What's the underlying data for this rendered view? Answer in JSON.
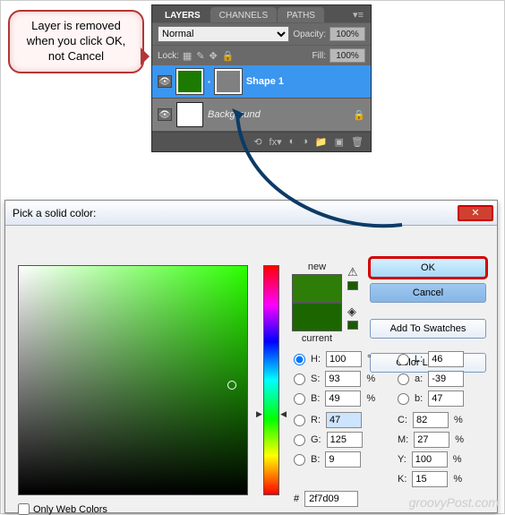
{
  "callout": {
    "text": "Layer is removed when you click OK, not Cancel"
  },
  "layers_panel": {
    "tabs": [
      "LAYERS",
      "CHANNELS",
      "PATHS"
    ],
    "blend_mode": "Normal",
    "opacity_label": "Opacity:",
    "opacity_val": "100%",
    "lock_label": "Lock:",
    "fill_label": "Fill:",
    "fill_val": "100%",
    "layers": [
      {
        "name": "Shape 1",
        "selected": true,
        "color": "#1c7a00"
      },
      {
        "name": "Background",
        "selected": false,
        "locked": true
      }
    ]
  },
  "color_picker": {
    "title": "Pick a solid color:",
    "new_label": "new",
    "current_label": "current",
    "buttons": {
      "ok": "OK",
      "cancel": "Cancel",
      "swatches": "Add To Swatches",
      "libraries": "Color Libraries"
    },
    "hsb": {
      "h": "100",
      "s": "93",
      "b": "49",
      "h_unit": "°",
      "pct": "%"
    },
    "lab": {
      "l": "46",
      "a": "-39",
      "b": "47"
    },
    "rgb": {
      "r": "47",
      "g": "125",
      "b": "9"
    },
    "cmyk": {
      "c": "82",
      "m": "27",
      "y": "100",
      "k": "15"
    },
    "hex": "2f7d09",
    "hex_prefix": "#",
    "only_web": "Only Web Colors",
    "new_swatch": "#2f7d09",
    "current_swatch": "#1c6600"
  },
  "watermark": "groovyPost.com"
}
